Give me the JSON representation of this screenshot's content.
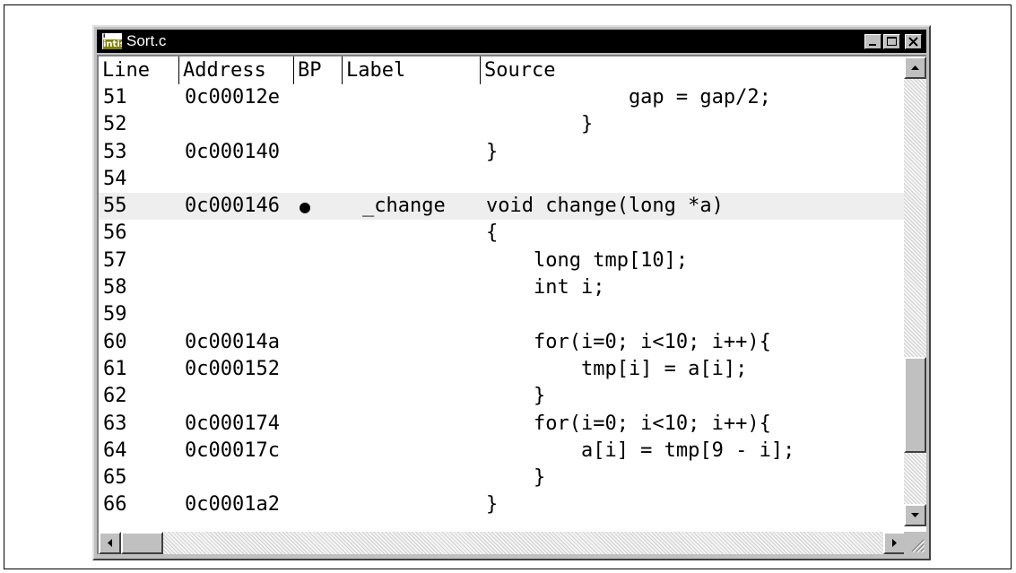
{
  "window": {
    "title": "Sort.c",
    "icon_label_top": "i",
    "icon_label_bottom": "intis",
    "icon": "app-icon",
    "controls": [
      "minimize-icon",
      "maximize-icon",
      "close-icon"
    ]
  },
  "columns": {
    "line": "Line",
    "address": "Address",
    "bp": "BP",
    "label": "Label",
    "source": "Source"
  },
  "rows": [
    {
      "line": "51",
      "address": "0c00012e",
      "bp": "",
      "label": "",
      "source": "            gap = gap/2;"
    },
    {
      "line": "52",
      "address": "",
      "bp": "",
      "label": "",
      "source": "        }"
    },
    {
      "line": "53",
      "address": "0c000140",
      "bp": "",
      "label": "",
      "source": "}"
    },
    {
      "line": "54",
      "address": "",
      "bp": "",
      "label": "",
      "source": ""
    },
    {
      "line": "55",
      "address": "0c000146",
      "bp": "●",
      "label": "_change",
      "source": "void change(long *a)"
    },
    {
      "line": "56",
      "address": "",
      "bp": "",
      "label": "",
      "source": "{"
    },
    {
      "line": "57",
      "address": "",
      "bp": "",
      "label": "",
      "source": "    long tmp[10];"
    },
    {
      "line": "58",
      "address": "",
      "bp": "",
      "label": "",
      "source": "    int i;"
    },
    {
      "line": "59",
      "address": "",
      "bp": "",
      "label": "",
      "source": ""
    },
    {
      "line": "60",
      "address": "0c00014a",
      "bp": "",
      "label": "",
      "source": "    for(i=0; i<10; i++){"
    },
    {
      "line": "61",
      "address": "0c000152",
      "bp": "",
      "label": "",
      "source": "        tmp[i] = a[i];"
    },
    {
      "line": "62",
      "address": "",
      "bp": "",
      "label": "",
      "source": "    }"
    },
    {
      "line": "63",
      "address": "0c000174",
      "bp": "",
      "label": "",
      "source": "    for(i=0; i<10; i++){"
    },
    {
      "line": "64",
      "address": "0c00017c",
      "bp": "",
      "label": "",
      "source": "        a[i] = tmp[9 - i];"
    },
    {
      "line": "65",
      "address": "",
      "bp": "",
      "label": "",
      "source": "    }"
    },
    {
      "line": "66",
      "address": "0c0001a2",
      "bp": "",
      "label": "",
      "source": "}"
    }
  ],
  "highlight_color": "#eeeeee",
  "highlighted_line": "55"
}
